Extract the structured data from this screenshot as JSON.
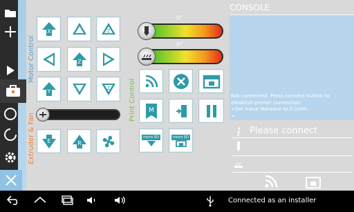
{
  "sidebar": {
    "items": [
      {
        "icon": "folder-icon"
      },
      {
        "icon": "plus-icon"
      },
      {
        "icon": "play-icon"
      },
      {
        "icon": "toolbox-icon",
        "active": true
      },
      {
        "icon": "circle-icon"
      },
      {
        "icon": "gear-icon"
      },
      {
        "icon": "close-icon"
      }
    ]
  },
  "labels": {
    "motor_control": "Motor Control",
    "extruder_fan": "Extruder & Fan",
    "print_control": "Print Control"
  },
  "motor_buttons": [
    {
      "glyph": "X",
      "dir": "up"
    },
    {
      "glyph": "",
      "dir": "up"
    },
    {
      "glyph": "Z",
      "dir": "up"
    },
    {
      "glyph": "",
      "dir": "left"
    },
    {
      "glyph": "Z",
      "dir": "up"
    },
    {
      "glyph": "",
      "dir": "right"
    },
    {
      "glyph": "Y",
      "dir": "down"
    },
    {
      "glyph": "",
      "dir": "down"
    },
    {
      "glyph": "Z",
      "dir": "down"
    }
  ],
  "extruder_buttons": [
    {
      "glyph": "E"
    },
    {
      "glyph": "R"
    },
    {
      "glyph": ""
    }
  ],
  "temps": {
    "extruder": "0°",
    "bed": "0°"
  },
  "print_buttons": {
    "row3_labels": [
      "micro SD",
      "micro SD"
    ]
  },
  "console": {
    "title": "CONSOLE",
    "lines": [
      "Not connected. Press connect button to",
      "establish printer connection.",
      ">Set move distance to 0.1mm",
      ">"
    ],
    "status": "Please connect"
  },
  "sysbar": {
    "notification": "Connected as an installer"
  },
  "colors": {
    "accent": "#8ec3e6",
    "tile_icon": "#2f9aa8",
    "motor_label": "#4aa3d8",
    "extruder_label": "#e8823a",
    "print_label": "#7cc04a"
  }
}
